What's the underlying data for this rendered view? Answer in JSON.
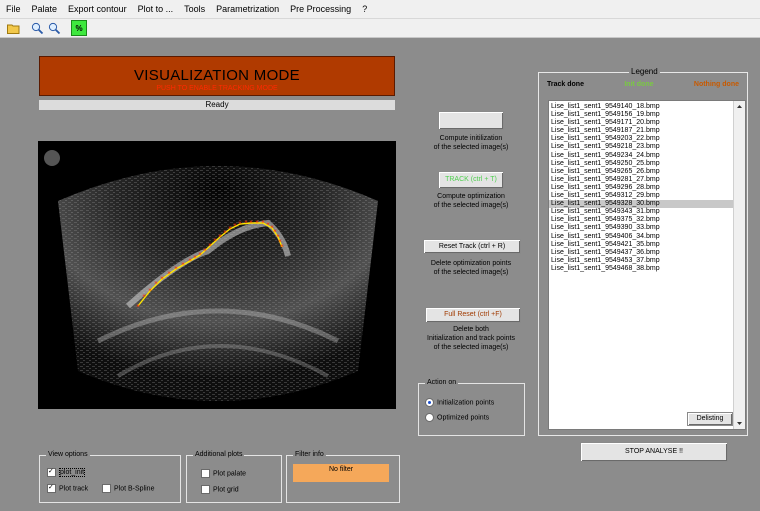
{
  "menu": [
    "File",
    "Palate",
    "Export contour",
    "Plot to ...",
    "Tools",
    "Parametrization",
    "Pre Processing",
    "?"
  ],
  "toolbar": {
    "icons": [
      "open-folder-icon",
      "zoom-in-icon",
      "zoom-out-icon",
      "green-edit-icon"
    ],
    "green_icon_text": "%"
  },
  "title": {
    "main": "VISUALIZATION MODE",
    "sub": "PUSH TO ENABLE TRACKING MODE",
    "bg_color": "#b03a00"
  },
  "status": "Ready",
  "buttons": {
    "compute_init_caption": "Compute initilization\nof the selected image(s)",
    "track_label": "TRACK (ctrl + T)",
    "track_caption": "Compute optimization\nof the selected image(s)",
    "reset_track_label": "Reset Track (ctrl + R)",
    "reset_track_caption": "Delete optimization points\nof the selected image(s)",
    "full_reset_label": "Full Reset  (ctrl +F)",
    "full_reset_caption": "Delete both\nInitialization and track points\nof the selected image(s)",
    "stop_label": "STOP ANALYSE !!",
    "delisting_label": "Delisting"
  },
  "action_on": {
    "title": "Action on",
    "options": [
      "Initialization points",
      "Optimized points"
    ],
    "selected": 0
  },
  "legend": {
    "title": "Legend",
    "track_done": "Track done",
    "init_done": "Init done",
    "nothing_done": "Nothing done",
    "init_color": "#7ac943",
    "nothing_color": "#c85a00"
  },
  "files": [
    "Lise_list1_sent1_9549140_18.bmp",
    "Lise_list1_sent1_9549156_19.bmp",
    "Lise_list1_sent1_9549171_20.bmp",
    "Lise_list1_sent1_9549187_21.bmp",
    "Lise_list1_sent1_9549203_22.bmp",
    "Lise_list1_sent1_9549218_23.bmp",
    "Lise_list1_sent1_9549234_24.bmp",
    "Lise_list1_sent1_9549250_25.bmp",
    "Lise_list1_sent1_9549265_26.bmp",
    "Lise_list1_sent1_9549281_27.bmp",
    "Lise_list1_sent1_9549296_28.bmp",
    "Lise_list1_sent1_9549312_29.bmp",
    "Lise_list1_sent1_9549328_30.bmp",
    "Lise_list1_sent1_9549343_31.bmp",
    "Lise_list1_sent1_9549375_32.bmp",
    "Lise_list1_sent1_9549390_33.bmp",
    "Lise_list1_sent1_9549406_34.bmp",
    "Lise_list1_sent1_9549421_35.bmp",
    "Lise_list1_sent1_9549437_36.bmp",
    "Lise_list1_sent1_9549453_37.bmp",
    "Lise_list1_sent1_9549468_38.bmp"
  ],
  "selected_file_index": 12,
  "view_options": {
    "title": "View options",
    "plot_init": "plot_init",
    "plot_track": "Plot  track",
    "plot_bspline": "Plot B-Spline",
    "checked": {
      "plot_init": true,
      "plot_track": true,
      "plot_bspline": false
    }
  },
  "additional_plots": {
    "title": "Additional plots",
    "plot_palate": "Plot palate",
    "plot_grid": "Plot grid"
  },
  "filter_info": {
    "title": "Filter info",
    "value": "No filter",
    "bg_color": "#f5a85a"
  }
}
